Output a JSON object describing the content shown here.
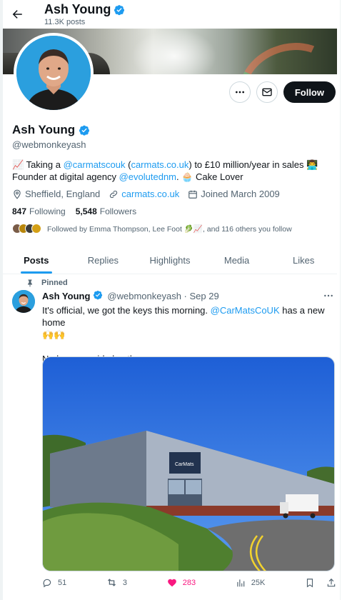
{
  "header": {
    "title": "Ash Young",
    "post_count": "11.3K posts"
  },
  "actions": {
    "follow_label": "Follow"
  },
  "profile": {
    "name": "Ash Young",
    "handle": "@webmonkeyash",
    "bio": {
      "line1_prefix": "📈 Taking a ",
      "line1_mention": "@carmatscouk",
      "line1_mid_open": " (",
      "line1_link": "carmats.co.uk",
      "line1_suffix": ") to £10 million/year in sales 👨‍💻",
      "line2_prefix": "Founder at digital agency ",
      "line2_mention": "@evolutednm",
      "line2_suffix": ". 🧁 Cake Lover"
    },
    "location": "Sheffield, England",
    "website": "carmats.co.uk",
    "joined": "Joined March 2009",
    "following_count": "847",
    "following_label": "Following",
    "followers_count": "5,548",
    "followers_label": "Followers",
    "followed_by": "Followed by Emma Thompson, Lee Foot 🥬📈, and 116 others you follow"
  },
  "tabs": [
    {
      "label": "Posts"
    },
    {
      "label": "Replies"
    },
    {
      "label": "Highlights"
    },
    {
      "label": "Media"
    },
    {
      "label": "Likes"
    }
  ],
  "tweet": {
    "pinned_label": "Pinned",
    "name": "Ash Young",
    "handle_date": "@webmonkeyash · Sep 29",
    "text_prefix": "It's official, we got the keys this morning. ",
    "text_mention": "@CarMatsCoUK",
    "text_suffix": " has a new home",
    "text_emoji": "🙌🙌",
    "text_line2": "No longer a side hustle now.",
    "media_sign": "CarMats",
    "replies": "51",
    "reposts": "3",
    "likes": "283",
    "views": "25K"
  },
  "colors": {
    "accent": "#1d9bf0",
    "like": "#f91880",
    "text": "#0f1419",
    "muted": "#536471"
  }
}
